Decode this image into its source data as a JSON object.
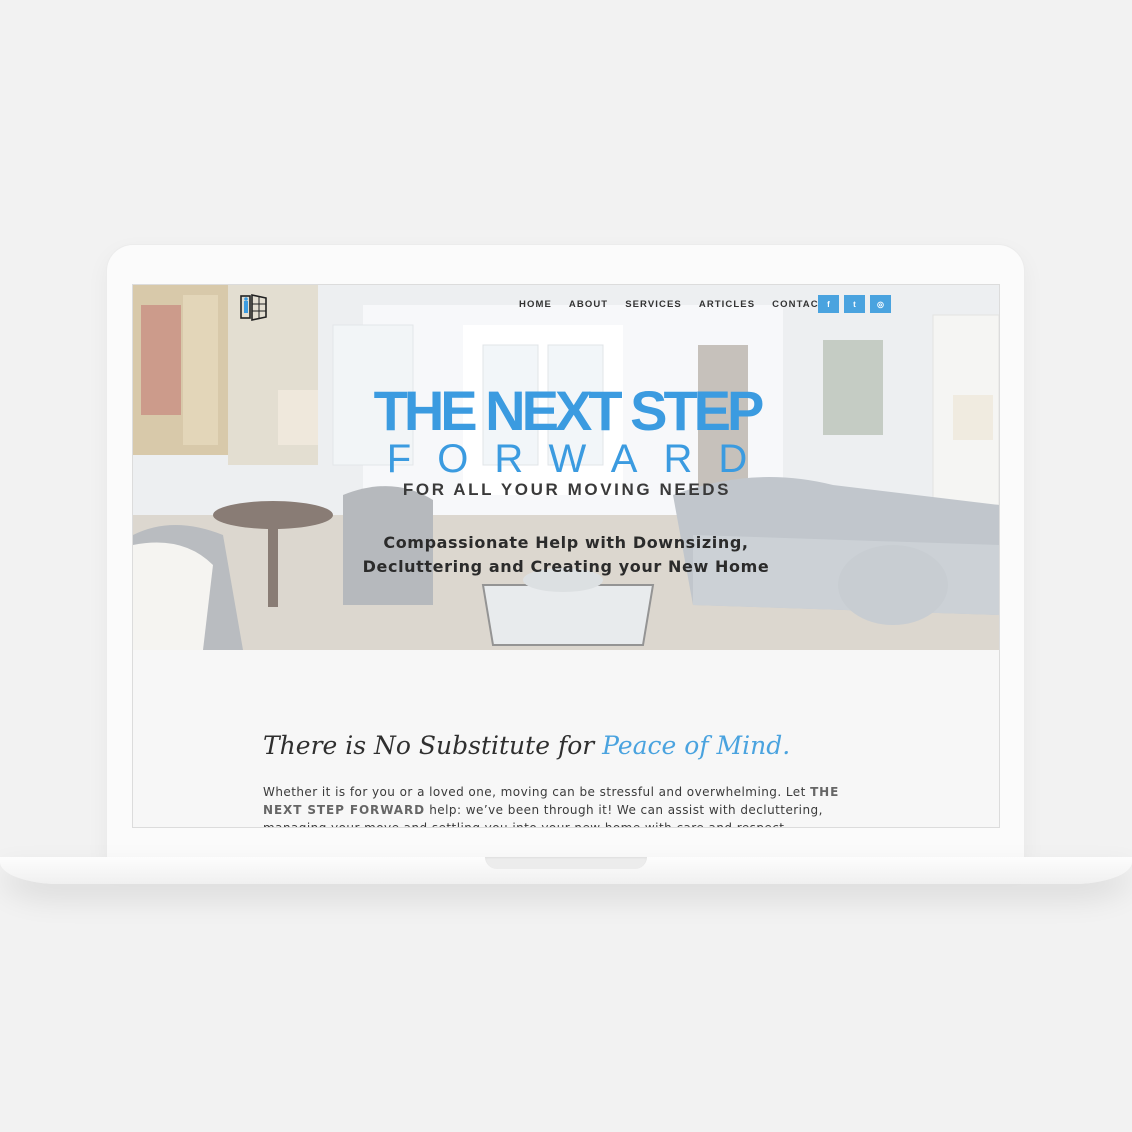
{
  "nav": {
    "items": [
      {
        "label": "HOME"
      },
      {
        "label": "ABOUT"
      },
      {
        "label": "SERVICES"
      },
      {
        "label": "ARTICLES"
      },
      {
        "label": "CONTACT"
      }
    ],
    "social": [
      {
        "icon": "facebook-icon",
        "glyph": "f"
      },
      {
        "icon": "twitter-icon",
        "glyph": "t"
      },
      {
        "icon": "instagram-icon",
        "glyph": "◎"
      }
    ]
  },
  "brand": {
    "line1": "THE NEXT STEP",
    "line2": "FORWARD",
    "line3": "FOR ALL YOUR MOVING NEEDS"
  },
  "hero": {
    "tagline_line1": "Compassionate Help with Downsizing,",
    "tagline_line2": "Decluttering and Creating your New Home"
  },
  "content": {
    "headline_plain": "There is No Substitute for ",
    "headline_accent": "Peace of Mind.",
    "body_part1": "Whether it is for you or a loved one, moving can be stressful and overwhelming. Let ",
    "body_strong": "THE NEXT STEP FORWARD",
    "body_part2": " help: we’ve been through it! We can assist with decluttering, managing your move and settling you into your new home with care and respect."
  },
  "colors": {
    "accent": "#4aa3df",
    "brand_blue": "#3b9be0",
    "text_dark": "#2f2f2f",
    "page_bg": "#f2f2f2"
  }
}
